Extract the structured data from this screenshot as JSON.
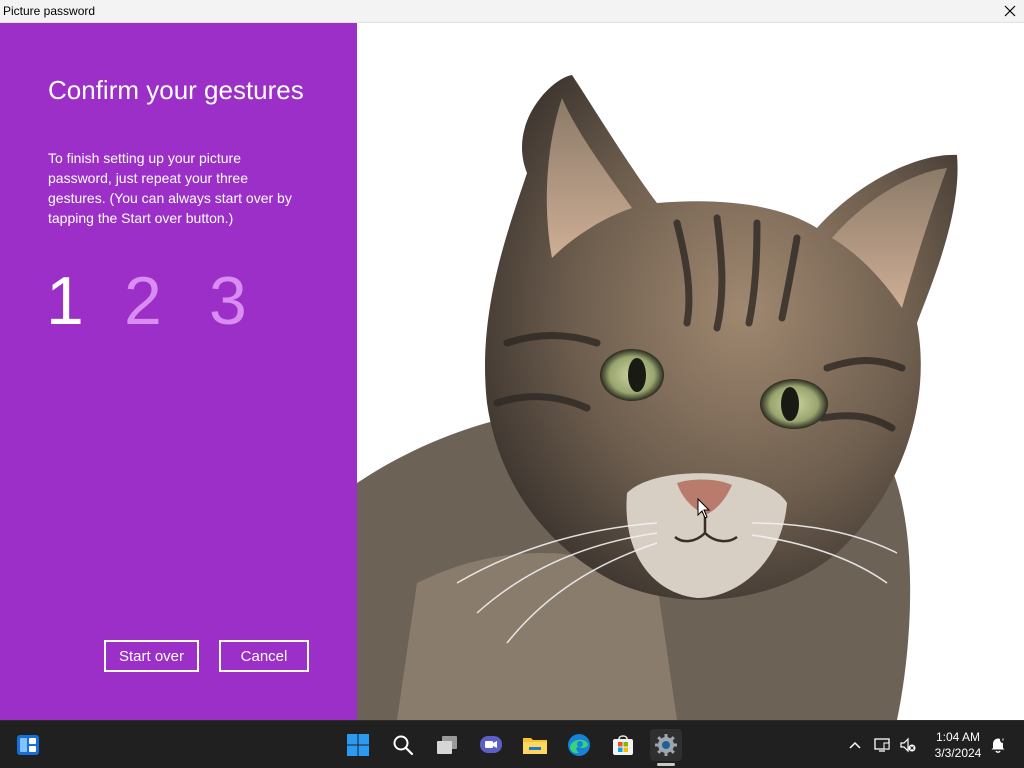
{
  "window": {
    "title": "Picture password",
    "close_label": "Close"
  },
  "panel": {
    "heading": "Confirm your gestures",
    "instructions": "To finish setting up your picture password, just repeat your three gestures. (You can always start over by tapping the Start over button.)",
    "steps": [
      "1",
      "2",
      "3"
    ],
    "current_step": 1,
    "start_over_label": "Start over",
    "cancel_label": "Cancel",
    "background_color": "#9b2fc7",
    "inactive_step_color": "#d98cf1"
  },
  "picture": {
    "subject": "tabby cat"
  },
  "taskbar": {
    "widgets_icon": "widgets-icon",
    "pinned": [
      "start-icon",
      "search-icon",
      "task-view-icon",
      "teams-chat-icon",
      "file-explorer-icon",
      "edge-icon",
      "store-icon",
      "settings-icon"
    ],
    "active_app": "settings-icon",
    "tray": [
      "chevron-up-icon",
      "network-icon",
      "volume-muted-icon",
      "notification-icon"
    ],
    "time": "1:04 AM",
    "date": "3/3/2024"
  }
}
